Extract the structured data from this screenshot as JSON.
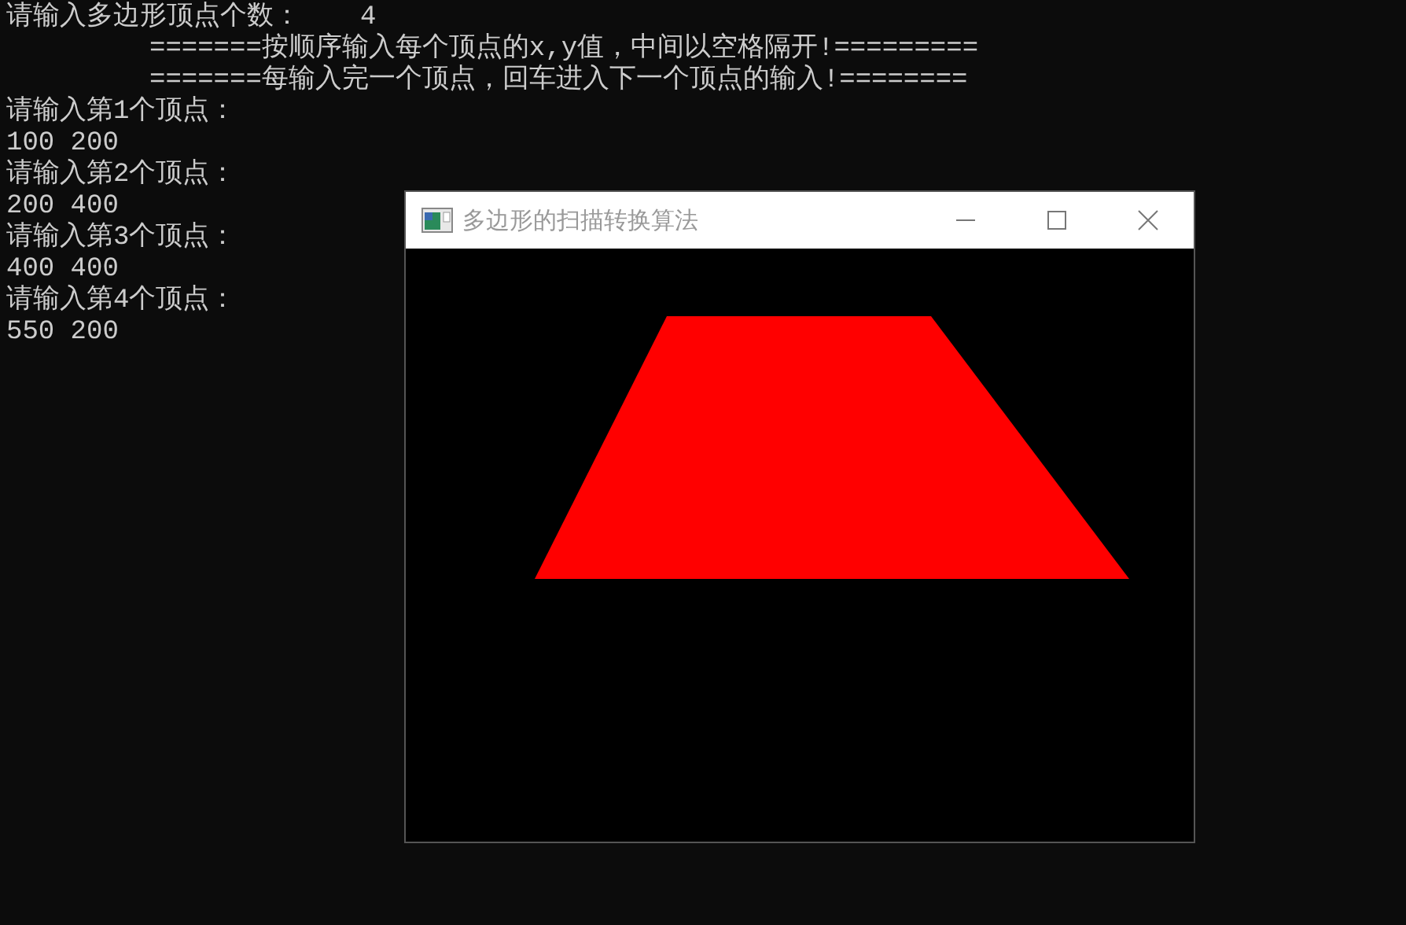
{
  "console": {
    "lines": [
      {
        "kind": "prompt",
        "text": "请输入多边形顶点个数：",
        "value": "4"
      },
      {
        "kind": "indented",
        "text": "=======按顺序输入每个顶点的x,y值，中间以空格隔开!========="
      },
      {
        "kind": "indented",
        "text": "=======每输入完一个顶点，回车进入下一个顶点的输入!========"
      },
      {
        "kind": "plain",
        "text": "请输入第1个顶点："
      },
      {
        "kind": "plain",
        "text": "100 200"
      },
      {
        "kind": "plain",
        "text": "请输入第2个顶点："
      },
      {
        "kind": "plain",
        "text": "200 400"
      },
      {
        "kind": "plain",
        "text": "请输入第3个顶点："
      },
      {
        "kind": "plain",
        "text": "400 400"
      },
      {
        "kind": "plain",
        "text": "请输入第4个顶点："
      },
      {
        "kind": "plain",
        "text": "550 200"
      }
    ]
  },
  "window": {
    "title": "多边形的扫描转换算法"
  }
}
